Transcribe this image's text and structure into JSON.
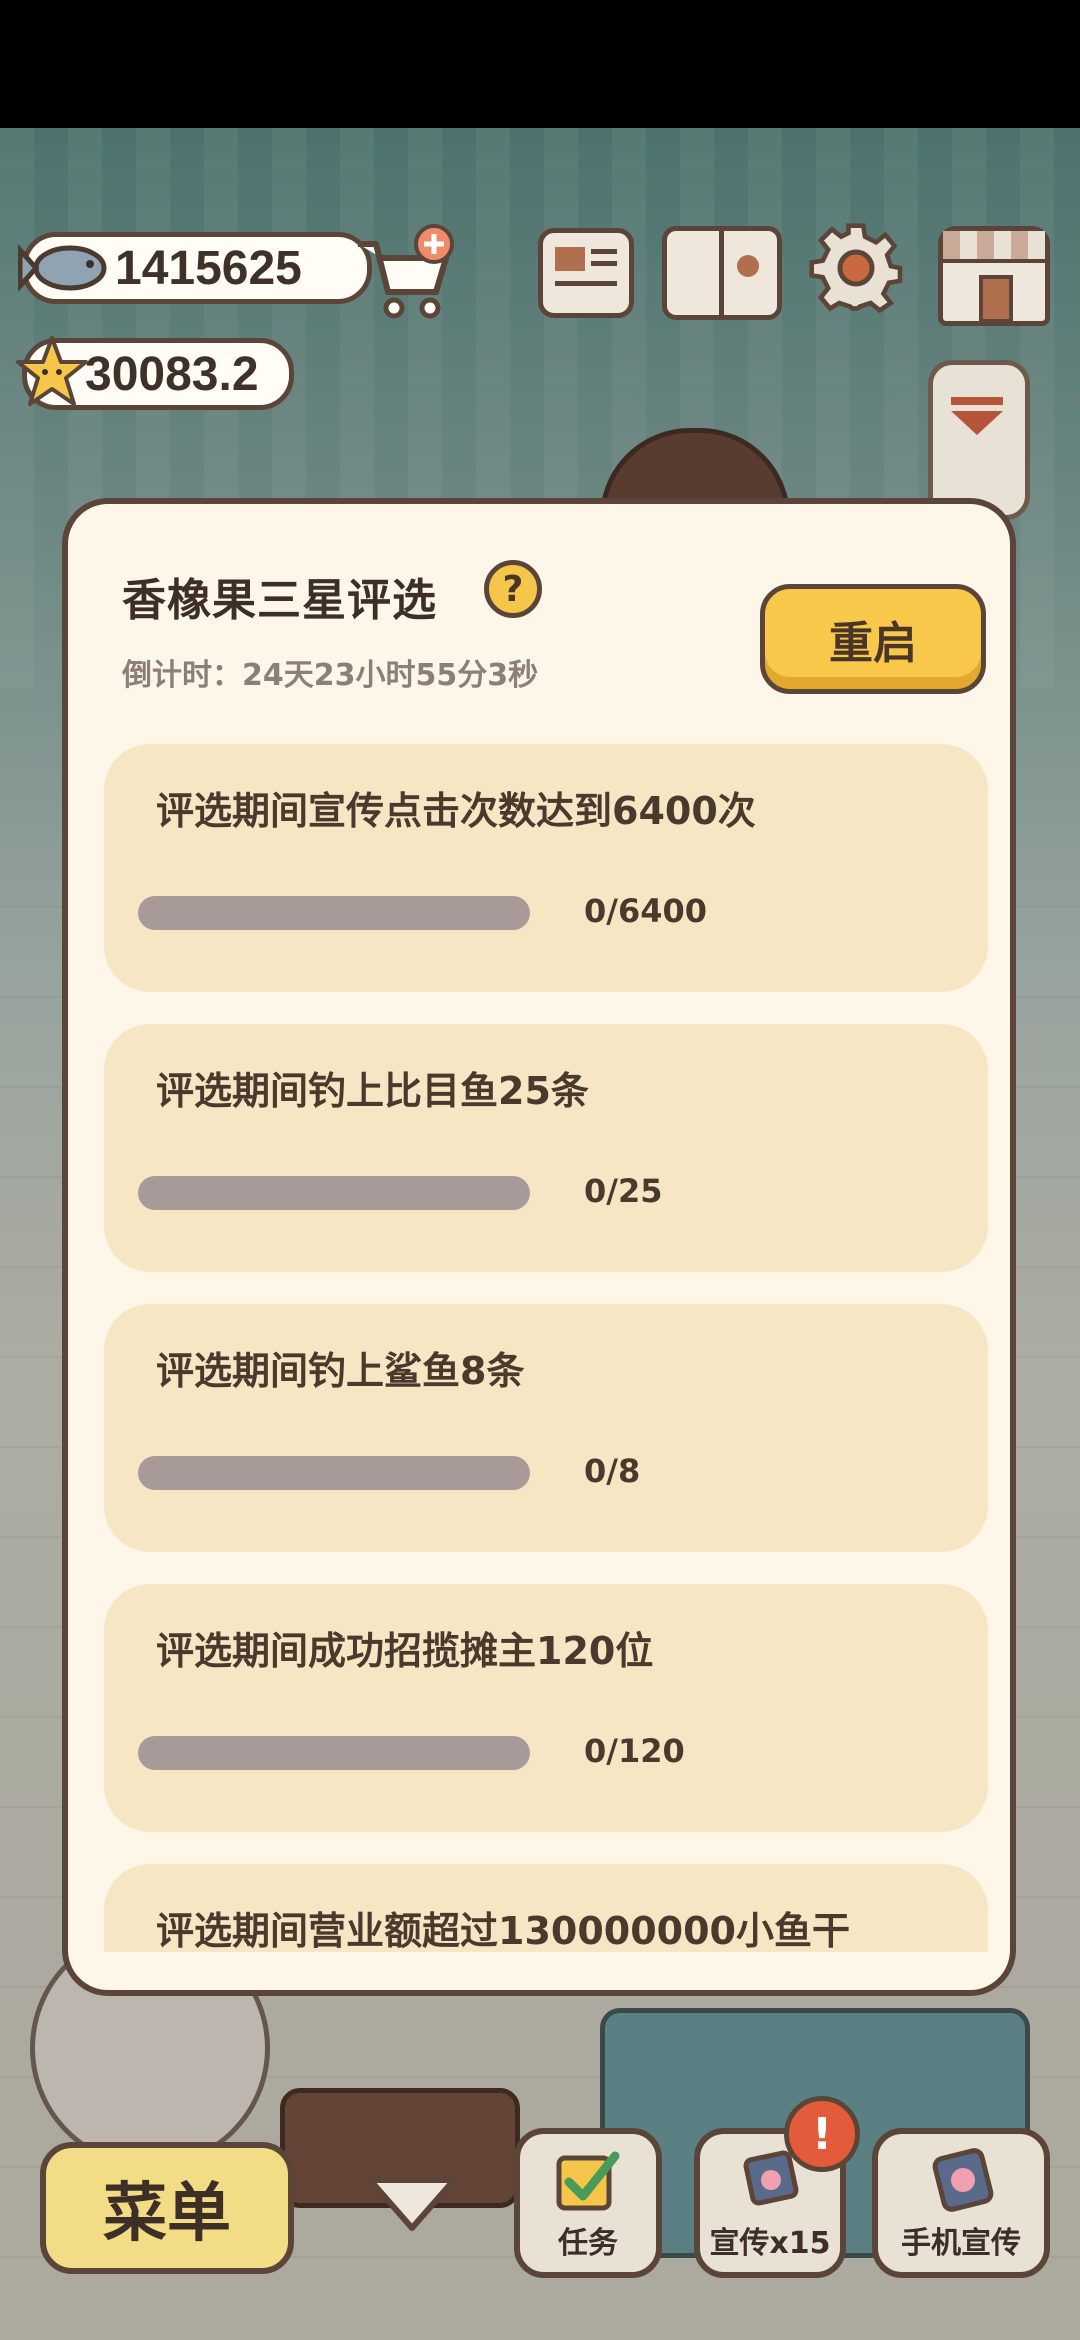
{
  "hud": {
    "fish_currency": "1415625",
    "star_currency": "30083.2"
  },
  "modal": {
    "title": "香橡果三星评选",
    "help_label": "?",
    "countdown": "倒计时：24天23小时55分3秒",
    "restart_label": "重启",
    "tasks": [
      {
        "text": "评选期间宣传点击次数达到6400次",
        "progress_text": "0/6400",
        "progress": 0
      },
      {
        "text": "评选期间钓上比目鱼25条",
        "progress_text": "0/25",
        "progress": 0
      },
      {
        "text": "评选期间钓上鲨鱼8条",
        "progress_text": "0/8",
        "progress": 0
      },
      {
        "text": "评选期间成功招揽摊主120位",
        "progress_text": "0/120",
        "progress": 0
      },
      {
        "text": "评选期间营业额超过130000000小鱼干",
        "progress_text": "",
        "progress": 0
      }
    ]
  },
  "bottom_bar": {
    "menu_label": "菜单",
    "task_label": "任务",
    "promo_label": "宣传x15",
    "phone_promo_label": "手机宣传",
    "alert_label": "!"
  },
  "icons": {
    "fish": "fish-icon",
    "star": "star-icon",
    "cart": "shop-cart-icon",
    "newspaper": "newspaper-icon",
    "book": "paw-book-icon",
    "settings": "gear-icon",
    "shop": "shop-icon"
  },
  "colors": {
    "accent_yellow": "#f7c84a",
    "card_bg": "#f6e6c4",
    "modal_bg": "#fdf6e9",
    "border": "#5b4538",
    "progress_track": "#a79a98"
  }
}
